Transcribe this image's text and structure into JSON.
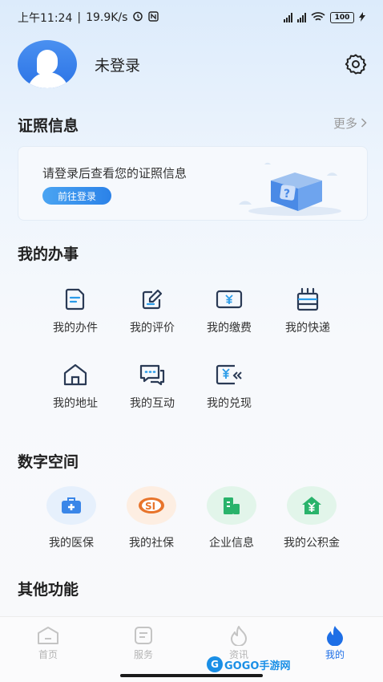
{
  "status_bar": {
    "time": "上午11:24",
    "separator": "|",
    "speed": "19.9K/s",
    "battery": "100"
  },
  "profile": {
    "username": "未登录"
  },
  "certificates": {
    "title": "证照信息",
    "more": "更多",
    "prompt": "请登录后查看您的证照信息",
    "login_button": "前往登录"
  },
  "affairs": {
    "title": "我的办事",
    "items": [
      {
        "label": "我的办件",
        "icon": "document-icon"
      },
      {
        "label": "我的评价",
        "icon": "edit-icon"
      },
      {
        "label": "我的缴费",
        "icon": "payment-icon"
      },
      {
        "label": "我的快递",
        "icon": "express-icon"
      },
      {
        "label": "我的地址",
        "icon": "house-icon"
      },
      {
        "label": "我的互动",
        "icon": "chat-icon"
      },
      {
        "label": "我的兑现",
        "icon": "redeem-icon"
      }
    ]
  },
  "digital_space": {
    "title": "数字空间",
    "items": [
      {
        "label": "我的医保",
        "icon": "medical-kit-icon",
        "color": "#3a86e8",
        "bg": "#e6f0fc"
      },
      {
        "label": "我的社保",
        "icon": "social-security-icon",
        "color": "#e8742b",
        "bg": "#fdeee2"
      },
      {
        "label": "企业信息",
        "icon": "building-icon",
        "color": "#29b36b",
        "bg": "#e2f5ea"
      },
      {
        "label": "我的公积金",
        "icon": "housing-fund-icon",
        "color": "#29b36b",
        "bg": "#e2f5ea"
      }
    ]
  },
  "other": {
    "title": "其他功能"
  },
  "tabbar": {
    "tabs": [
      {
        "label": "首页",
        "icon": "home-icon",
        "active": false
      },
      {
        "label": "服务",
        "icon": "service-icon",
        "active": false
      },
      {
        "label": "资讯",
        "icon": "news-icon",
        "active": false
      },
      {
        "label": "我的",
        "icon": "mine-icon",
        "active": true
      }
    ]
  },
  "watermark": {
    "badge": "G",
    "text": "GOGO手游网"
  },
  "colors": {
    "accent": "#1e6fe6",
    "icon_stroke": "#2a3a55"
  }
}
